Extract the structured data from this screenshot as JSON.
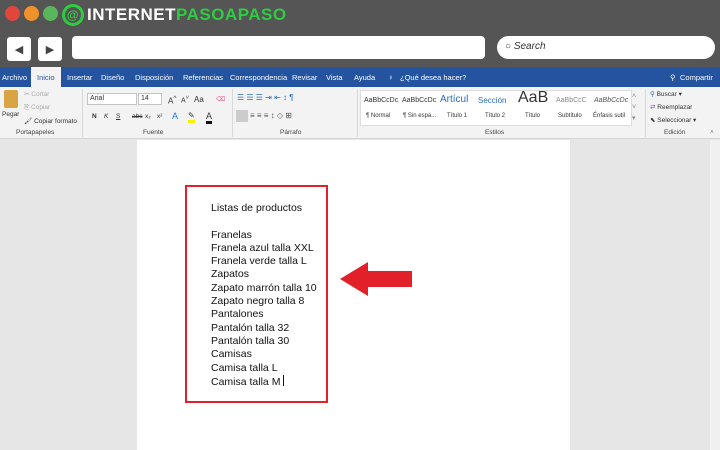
{
  "window": {
    "colors": {
      "close": "#e0463c",
      "minimize": "#f0922c",
      "maximize": "#5ab65a",
      "brand_green": "#2ecc40"
    },
    "logo": {
      "part1": "INTERNET",
      "part2": "PASOAPASO"
    }
  },
  "browser": {
    "back_icon": "◀",
    "forward_icon": "▶",
    "url_value": "",
    "search_placeholder": "Search"
  },
  "tabs": [
    "Archivo",
    "Inicio",
    "Insertar",
    "Diseño",
    "Disposición",
    "Referencias",
    "Correspondencia",
    "Revisar",
    "Vista",
    "Ayuda"
  ],
  "tell_me": "¿Qué desea hacer?",
  "share": "Compartir",
  "ribbon": {
    "clipboard": {
      "paste": "Pegar",
      "cut": "Cortar",
      "copy": "Copiar",
      "format_painter": "Copiar formato",
      "label": "Portapapeles"
    },
    "font": {
      "name": "Arial",
      "size": "14",
      "bold": "N",
      "italic": "K",
      "underline": "S",
      "strike": "abc",
      "sub": "x₂",
      "sup": "x²",
      "case": "Aa",
      "label": "Fuente"
    },
    "paragraph": {
      "label": "Párrafo"
    },
    "styles": {
      "items": [
        {
          "preview": "AaBbCcDc",
          "name": "¶ Normal"
        },
        {
          "preview": "AaBbCcDc",
          "name": "¶ Sin espa..."
        },
        {
          "preview": "Artícul",
          "name": "Título 1"
        },
        {
          "preview": "Sección",
          "name": "Título 2"
        },
        {
          "preview": "AaB",
          "name": "Título"
        },
        {
          "preview": "AaBbCcC",
          "name": "Subtítulo"
        },
        {
          "preview": "AaBbCcDc",
          "name": "Énfasis sutil"
        }
      ],
      "label": "Estilos"
    },
    "editing": {
      "find": "Buscar",
      "replace": "Reemplazar",
      "select": "Seleccionar",
      "label": "Edición"
    }
  },
  "document": {
    "lines": [
      "Listas de productos",
      "",
      "Franelas",
      "Franela azul talla XXL",
      "Franela verde talla L",
      "Zapatos",
      "Zapato marrón talla 10",
      "Zapato negro talla 8",
      "Pantalones",
      "Pantalón talla 32",
      "Pantalón talla 30",
      "Camisas",
      "Camisa talla L",
      "Camisa talla M"
    ]
  },
  "annotation": {
    "color": "#e2202a"
  }
}
